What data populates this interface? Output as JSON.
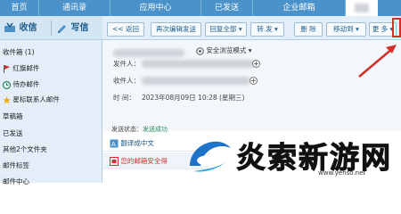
{
  "top_tabs": [
    "首页",
    "通讯录",
    "应用中心",
    "已发送",
    "企业邮箱"
  ],
  "sidebar": {
    "receive_label": "收信",
    "compose_label": "写信",
    "folders": [
      {
        "label": "收件箱 (1)",
        "icon": "inbox-icon"
      },
      {
        "label": "红旗邮件",
        "icon": "red-flag-icon"
      },
      {
        "label": "待办邮件",
        "icon": "todo-icon"
      },
      {
        "label": "星标联系人邮件",
        "icon": "star-icon"
      },
      {
        "label": "草稿箱",
        "icon": ""
      },
      {
        "label": "已发送",
        "icon": ""
      },
      {
        "label": "其他2个文件夹",
        "icon": ""
      },
      {
        "label": "邮件标签",
        "icon": ""
      },
      {
        "label": "邮件中心",
        "icon": ""
      }
    ]
  },
  "toolbar": {
    "back": "<< 返回",
    "edit_resend": "再次编辑发送",
    "reply_all": "回复全部",
    "reply_all_arrow": "▾",
    "forward": "转 发",
    "forward_arrow": "▾",
    "delete": "删 除",
    "move_to": "移动到",
    "move_arrow": "▾",
    "more": "更 多",
    "more_arrow": "▾"
  },
  "mail": {
    "secure_mode": "安全浏览模式",
    "secure_arrow": "▾",
    "from_label": "发件人：",
    "to_label": "收件人：",
    "time_label": "时 间：",
    "time_value": "2023年08月09日 10:28 (星期三)",
    "status_label": "发送状态：",
    "status_value": "发送成功",
    "translate": "翻译成中文",
    "security_notice": "您的邮箱安全得"
  },
  "watermark": {
    "text": "炎索新游网",
    "url": "www.yenso.net"
  },
  "colors": {
    "tab_bar": "#4a92c9",
    "sidebar_bg": "#e3eef8",
    "accent": "#1f5e8c",
    "status_green": "#2e8b57",
    "highlight_red": "#d0312d"
  }
}
